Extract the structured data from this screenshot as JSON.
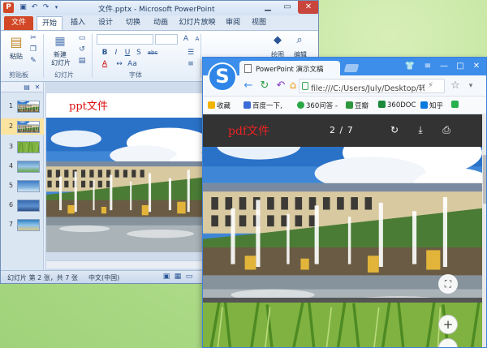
{
  "ppt": {
    "window_title": "文件.pptx - Microsoft PowerPoint",
    "app_icon": "P",
    "tabs": [
      "文件",
      "开始",
      "插入",
      "设计",
      "切换",
      "动画",
      "幻灯片放映",
      "审阅",
      "视图"
    ],
    "active_tab": "开始",
    "ribbon": {
      "paste_label": "粘贴",
      "new_slide_label_1": "新建",
      "new_slide_label_2": "幻灯片",
      "group_clipboard": "剪贴板",
      "group_slides": "幻灯片",
      "group_font": "字体",
      "drawing_label": "绘图",
      "editing_label": "编辑",
      "font_size_value": "A",
      "bold": "B",
      "italic": "I",
      "underline": "U",
      "strike": "S",
      "shadow": "abc",
      "font_color": "A"
    },
    "thumbnails": [
      {
        "num": "1",
        "color": "#6b8fb5"
      },
      {
        "num": "2",
        "color": "#8aa0b8"
      },
      {
        "num": "3",
        "color": "#4f8a3a"
      },
      {
        "num": "4",
        "color": "#5a94c8"
      },
      {
        "num": "5",
        "color": "#3f7bc6"
      },
      {
        "num": "6",
        "color": "#3568b0"
      },
      {
        "num": "7",
        "color": "#2f7fc1"
      }
    ],
    "selected_slide": 2,
    "slide_label": "ppt文件",
    "status": {
      "slide_info": "幻灯片 第 2 张，共 7 张",
      "language": "中文(中国)"
    }
  },
  "browser": {
    "logo_letter": "S",
    "tab_title": "PowerPoint 演示文稿",
    "url": "file:///C:/Users/July/Desktop/转",
    "bookmarks": [
      {
        "label": "收藏",
        "color": "#f3b400"
      },
      {
        "label": "百度一下,",
        "color": "#3b6bd6"
      },
      {
        "label": "360问答 -",
        "color": "#28a745"
      },
      {
        "label": "豆瓣",
        "color": "#2e963d"
      },
      {
        "label": "360DOC",
        "color": "#1b8a3a"
      },
      {
        "label": "知乎",
        "color": "#0a7bde"
      },
      {
        "label": "",
        "color": "#27b14d"
      }
    ],
    "pdf": {
      "label": "pdf文件",
      "page_indicator": "2 / 7",
      "zoom_in": "+",
      "zoom_out": "−"
    }
  },
  "colors": {
    "ppt_accent": "#d24726",
    "browser_accent": "#3d8eea",
    "pdf_toolbar": "#333333",
    "desktop": "#b5df8e"
  }
}
